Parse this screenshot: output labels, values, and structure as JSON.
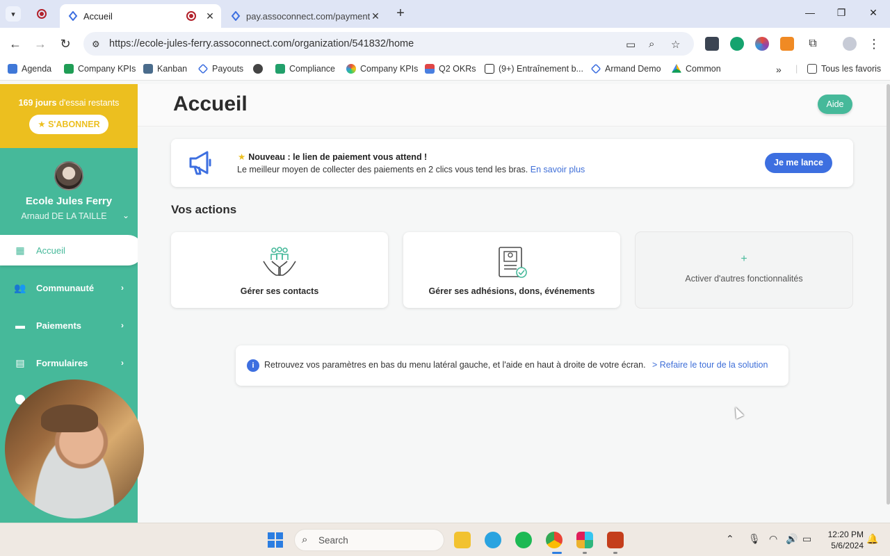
{
  "browser": {
    "tabs": [
      {
        "title": "Accueil",
        "active": true
      },
      {
        "title": "pay.assoconnect.com/payment",
        "active": false
      }
    ],
    "url": "https://ecole-jules-ferry.assoconnect.com/organization/541832/home",
    "bookmarks": [
      {
        "label": "Agenda",
        "icon": "calendar-icon"
      },
      {
        "label": "Company KPIs",
        "icon": "sheets-icon"
      },
      {
        "label": "Kanban",
        "icon": "kanban-icon"
      },
      {
        "label": "Payouts",
        "icon": "assoconnect-icon"
      },
      {
        "label": "",
        "icon": "globe-icon"
      },
      {
        "label": "Compliance",
        "icon": "compliance-icon"
      },
      {
        "label": "Company KPIs",
        "icon": "looker-icon"
      },
      {
        "label": "Q2 OKRs",
        "icon": "okr-icon"
      },
      {
        "label": "(9+) Entraînement b...",
        "icon": "notion-icon"
      },
      {
        "label": "Armand Demo",
        "icon": "assoconnect-icon"
      },
      {
        "label": "Common",
        "icon": "drive-icon"
      }
    ],
    "all_bookmarks": "Tous les favoris"
  },
  "sidebar": {
    "trial_days": "169 jours",
    "trial_text": " d'essai restants",
    "subscribe_label": "S'ABONNER",
    "org_name": "Ecole Jules Ferry",
    "user_name": "Arnaud DE LA TAILLE",
    "items": [
      {
        "label": "Accueil",
        "icon": "dashboard-icon",
        "active": true
      },
      {
        "label": "Communauté",
        "icon": "community-icon"
      },
      {
        "label": "Paiements",
        "icon": "card-icon"
      },
      {
        "label": "Formulaires",
        "icon": "form-icon"
      }
    ]
  },
  "main": {
    "title": "Accueil",
    "help_label": "Aide",
    "promo": {
      "title": "Nouveau : le lien de paiement vous attend !",
      "desc": "Le meilleur moyen de collecter des paiements en 2 clics vous tend les bras.",
      "link": "En savoir plus",
      "cta": "Je me lance"
    },
    "actions_title": "Vos actions",
    "actions": [
      {
        "label": "Gérer ses contacts",
        "icon": "hands-people-icon"
      },
      {
        "label": "Gérer ses adhésions, dons, événements",
        "icon": "membership-card-icon"
      },
      {
        "label": "Activer d'autres fonctionnalités",
        "icon": "plus-icon"
      }
    ],
    "tip": {
      "text": "Retrouvez vos paramètres en bas du menu latéral gauche, et l'aide en haut à droite de votre écran.",
      "link": "> Refaire le tour de la solution"
    }
  },
  "taskbar": {
    "search_placeholder": "Search",
    "time": "12:20 PM",
    "date": "5/6/2024"
  },
  "colors": {
    "brand_green": "#46b99a",
    "trial_yellow": "#ecbf1f",
    "primary_blue": "#3d6fe0"
  }
}
